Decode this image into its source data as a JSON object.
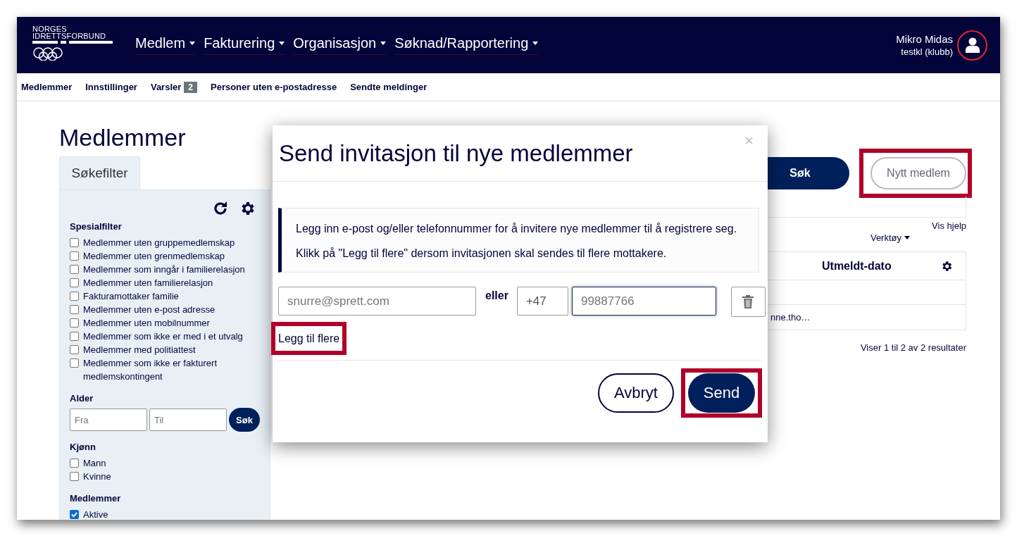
{
  "header": {
    "logo": {
      "line1": "NORGES",
      "line2": "IDRETTSFORBUND"
    },
    "nav": [
      {
        "label": "Medlem"
      },
      {
        "label": "Fakturering"
      },
      {
        "label": "Organisasjon"
      },
      {
        "label": "Søknad/Rapportering"
      }
    ],
    "user": {
      "name": "Mikro Midas",
      "org": "testkl (klubb)"
    }
  },
  "subnav": [
    {
      "label": "Medlemmer"
    },
    {
      "label": "Innstillinger"
    },
    {
      "label": "Varsler",
      "badge": "2"
    },
    {
      "label": "Personer uten e-postadresse"
    },
    {
      "label": "Sendte meldinger"
    }
  ],
  "page_title": "Medlemmer",
  "filter": {
    "tab": {
      "label": "Søkefilter",
      "selected": true
    },
    "sections": [
      {
        "kind": "checkboxes",
        "title": "Spesialfilter",
        "items": [
          {
            "label": "Medlemmer uten gruppemedlemskap",
            "checked": false
          },
          {
            "label": "Medlemmer uten grenmedlemskap",
            "checked": false
          },
          {
            "label": "Medlemmer som inngår i familierelasjon",
            "checked": false
          },
          {
            "label": "Medlemmer uten familierelasjon",
            "checked": false
          },
          {
            "label": "Fakturamottaker familie",
            "checked": false
          },
          {
            "label": "Medlemmer uten e-post adresse",
            "checked": false
          },
          {
            "label": "Medlemmer uten mobilnummer",
            "checked": false
          },
          {
            "label": "Medlemmer som ikke er med i et utvalg",
            "checked": false
          },
          {
            "label": "Medlemmer med politiattest",
            "checked": false
          },
          {
            "label": "Medlemmer som ikke er fakturert medlemskontingent",
            "checked": false
          }
        ]
      },
      {
        "kind": "range",
        "title": "Alder",
        "from_placeholder": "Fra",
        "to_placeholder": "Til",
        "button": "Søk"
      },
      {
        "kind": "checkboxes",
        "title": "Kjønn",
        "items": [
          {
            "label": "Mann",
            "checked": false
          },
          {
            "label": "Kvinne",
            "checked": false
          }
        ]
      },
      {
        "kind": "checkboxes",
        "title": "Medlemmer",
        "items": [
          {
            "label": "Aktive",
            "checked": true
          }
        ]
      }
    ]
  },
  "results": {
    "search_button": "Søk",
    "new_member_button": {
      "label": "Nytt medlem",
      "highlighted": true
    },
    "help_link": "Vis hjelp",
    "tools_menu": "Verktøy",
    "table": {
      "column": "Utmeldt-dato",
      "visible_cells": [
        "nne.tho…"
      ]
    },
    "count": "Viser 1 til 2 av 2 resultater"
  },
  "modal": {
    "title": "Send invitasjon til nye medlemmer",
    "close": "×",
    "info": [
      "Legg inn e-post og/eller telefonnummer for å invitere nye medlemmer til å registrere seg.",
      "Klikk på \"Legg til flere\" dersom invitasjonen skal sendes til flere mottakere."
    ],
    "email": {
      "placeholder": "snurre@sprett.com"
    },
    "separator": "eller",
    "country_code": {
      "value": "+47"
    },
    "phone": {
      "placeholder": "99887766"
    },
    "add_more": {
      "label": "Legg til flere",
      "highlighted": true
    },
    "cancel_button": {
      "label": "Avbryt",
      "highlighted": false
    },
    "send_button": {
      "label": "Send",
      "highlighted": true
    }
  }
}
